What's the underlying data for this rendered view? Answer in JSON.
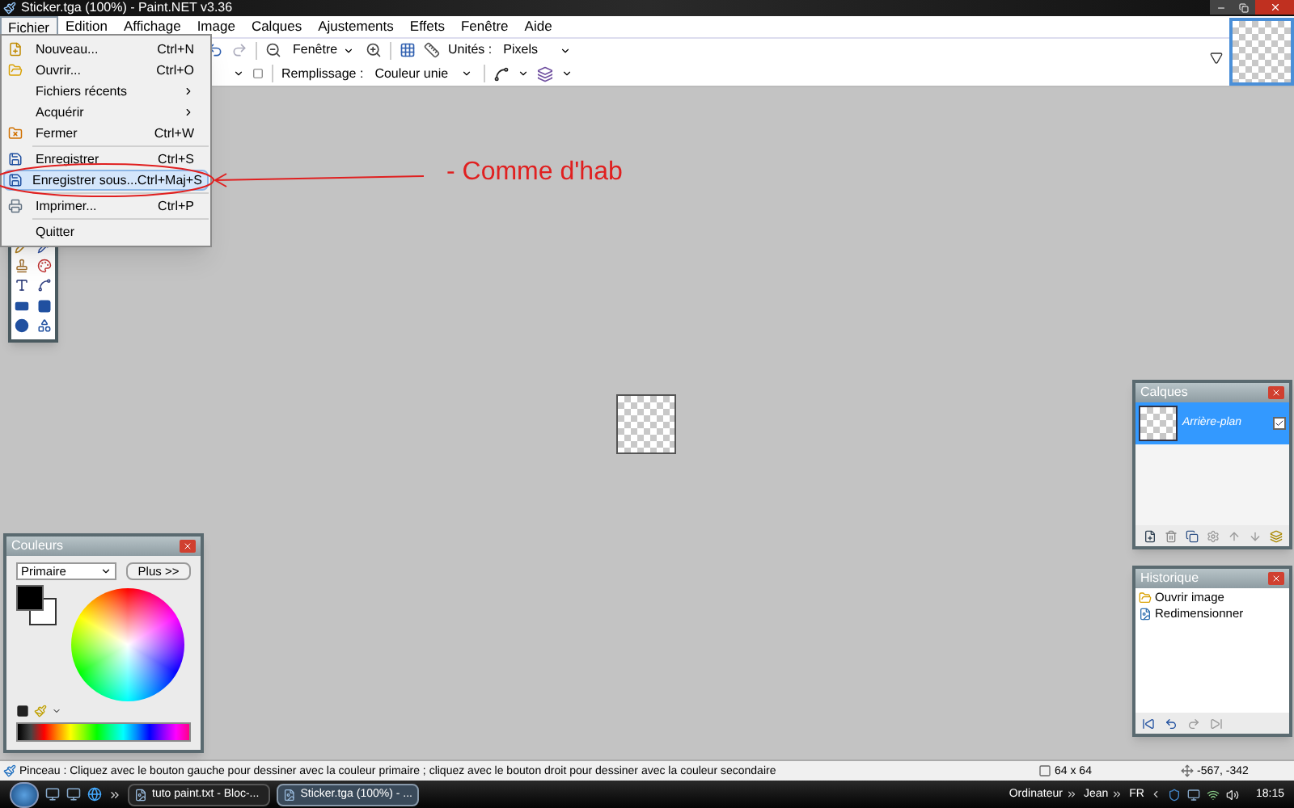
{
  "window": {
    "title": "Sticker.tga (100%) - Paint.NET v3.36"
  },
  "menu_bar": [
    {
      "label": "Fichier",
      "selected": true
    },
    {
      "label": "Edition",
      "selected": false
    },
    {
      "label": "Affichage",
      "selected": false
    },
    {
      "label": "Image",
      "selected": false
    },
    {
      "label": "Calques",
      "selected": false
    },
    {
      "label": "Ajustements",
      "selected": false
    },
    {
      "label": "Effets",
      "selected": false
    },
    {
      "label": "Fenêtre",
      "selected": false
    },
    {
      "label": "Aide",
      "selected": false
    }
  ],
  "file_menu": [
    {
      "kind": "item",
      "label": "Nouveau...",
      "shortcut": "Ctrl+N",
      "selected": false
    },
    {
      "kind": "item",
      "label": "Ouvrir...",
      "shortcut": "Ctrl+O",
      "selected": false
    },
    {
      "kind": "submenu",
      "label": "Fichiers récents",
      "selected": false
    },
    {
      "kind": "submenu",
      "label": "Acquérir",
      "selected": false
    },
    {
      "kind": "item",
      "label": "Fermer",
      "shortcut": "Ctrl+W",
      "selected": false
    },
    {
      "kind": "separator"
    },
    {
      "kind": "item",
      "label": "Enregistrer",
      "shortcut": "Ctrl+S",
      "selected": false
    },
    {
      "kind": "item",
      "label": "Enregistrer sous...",
      "shortcut": "Ctrl+Maj+S",
      "selected": true
    },
    {
      "kind": "separator"
    },
    {
      "kind": "item",
      "label": "Imprimer...",
      "shortcut": "Ctrl+P",
      "selected": false
    },
    {
      "kind": "separator"
    },
    {
      "kind": "item",
      "label": "Quitter",
      "selected": false
    }
  ],
  "toolbar": {
    "zoom_value": "Fenêtre",
    "units_label": "Unités :",
    "units_value": "Pixels",
    "fill_label": "Remplissage :",
    "fill_value": "Couleur unie"
  },
  "annotation": {
    "text": "- Comme d'hab"
  },
  "colors_panel": {
    "title": "Couleurs",
    "mode": "Primaire",
    "more_button": "Plus >>"
  },
  "layers_panel": {
    "title": "Calques",
    "layers": [
      {
        "name": "Arrière-plan",
        "selected": true,
        "visible": true
      }
    ]
  },
  "history_panel": {
    "title": "Historique",
    "items": [
      {
        "label": "Ouvrir image"
      },
      {
        "label": "Redimensionner"
      }
    ]
  },
  "status_bar": {
    "hint": "Pinceau : Cliquez avec le bouton gauche pour dessiner avec la couleur primaire ; cliquez avec le bouton droit pour dessiner avec la couleur secondaire",
    "size": "64 x 64",
    "cursor": "-567, -342"
  },
  "taskbar": {
    "tasks": [
      {
        "label": "tuto paint.txt - Bloc-...",
        "selected": false
      },
      {
        "label": "Sticker.tga (100%) - ...",
        "selected": true
      }
    ],
    "toolbars": [
      "Ordinateur",
      "Jean"
    ],
    "language": "FR",
    "clock": "18:15"
  }
}
